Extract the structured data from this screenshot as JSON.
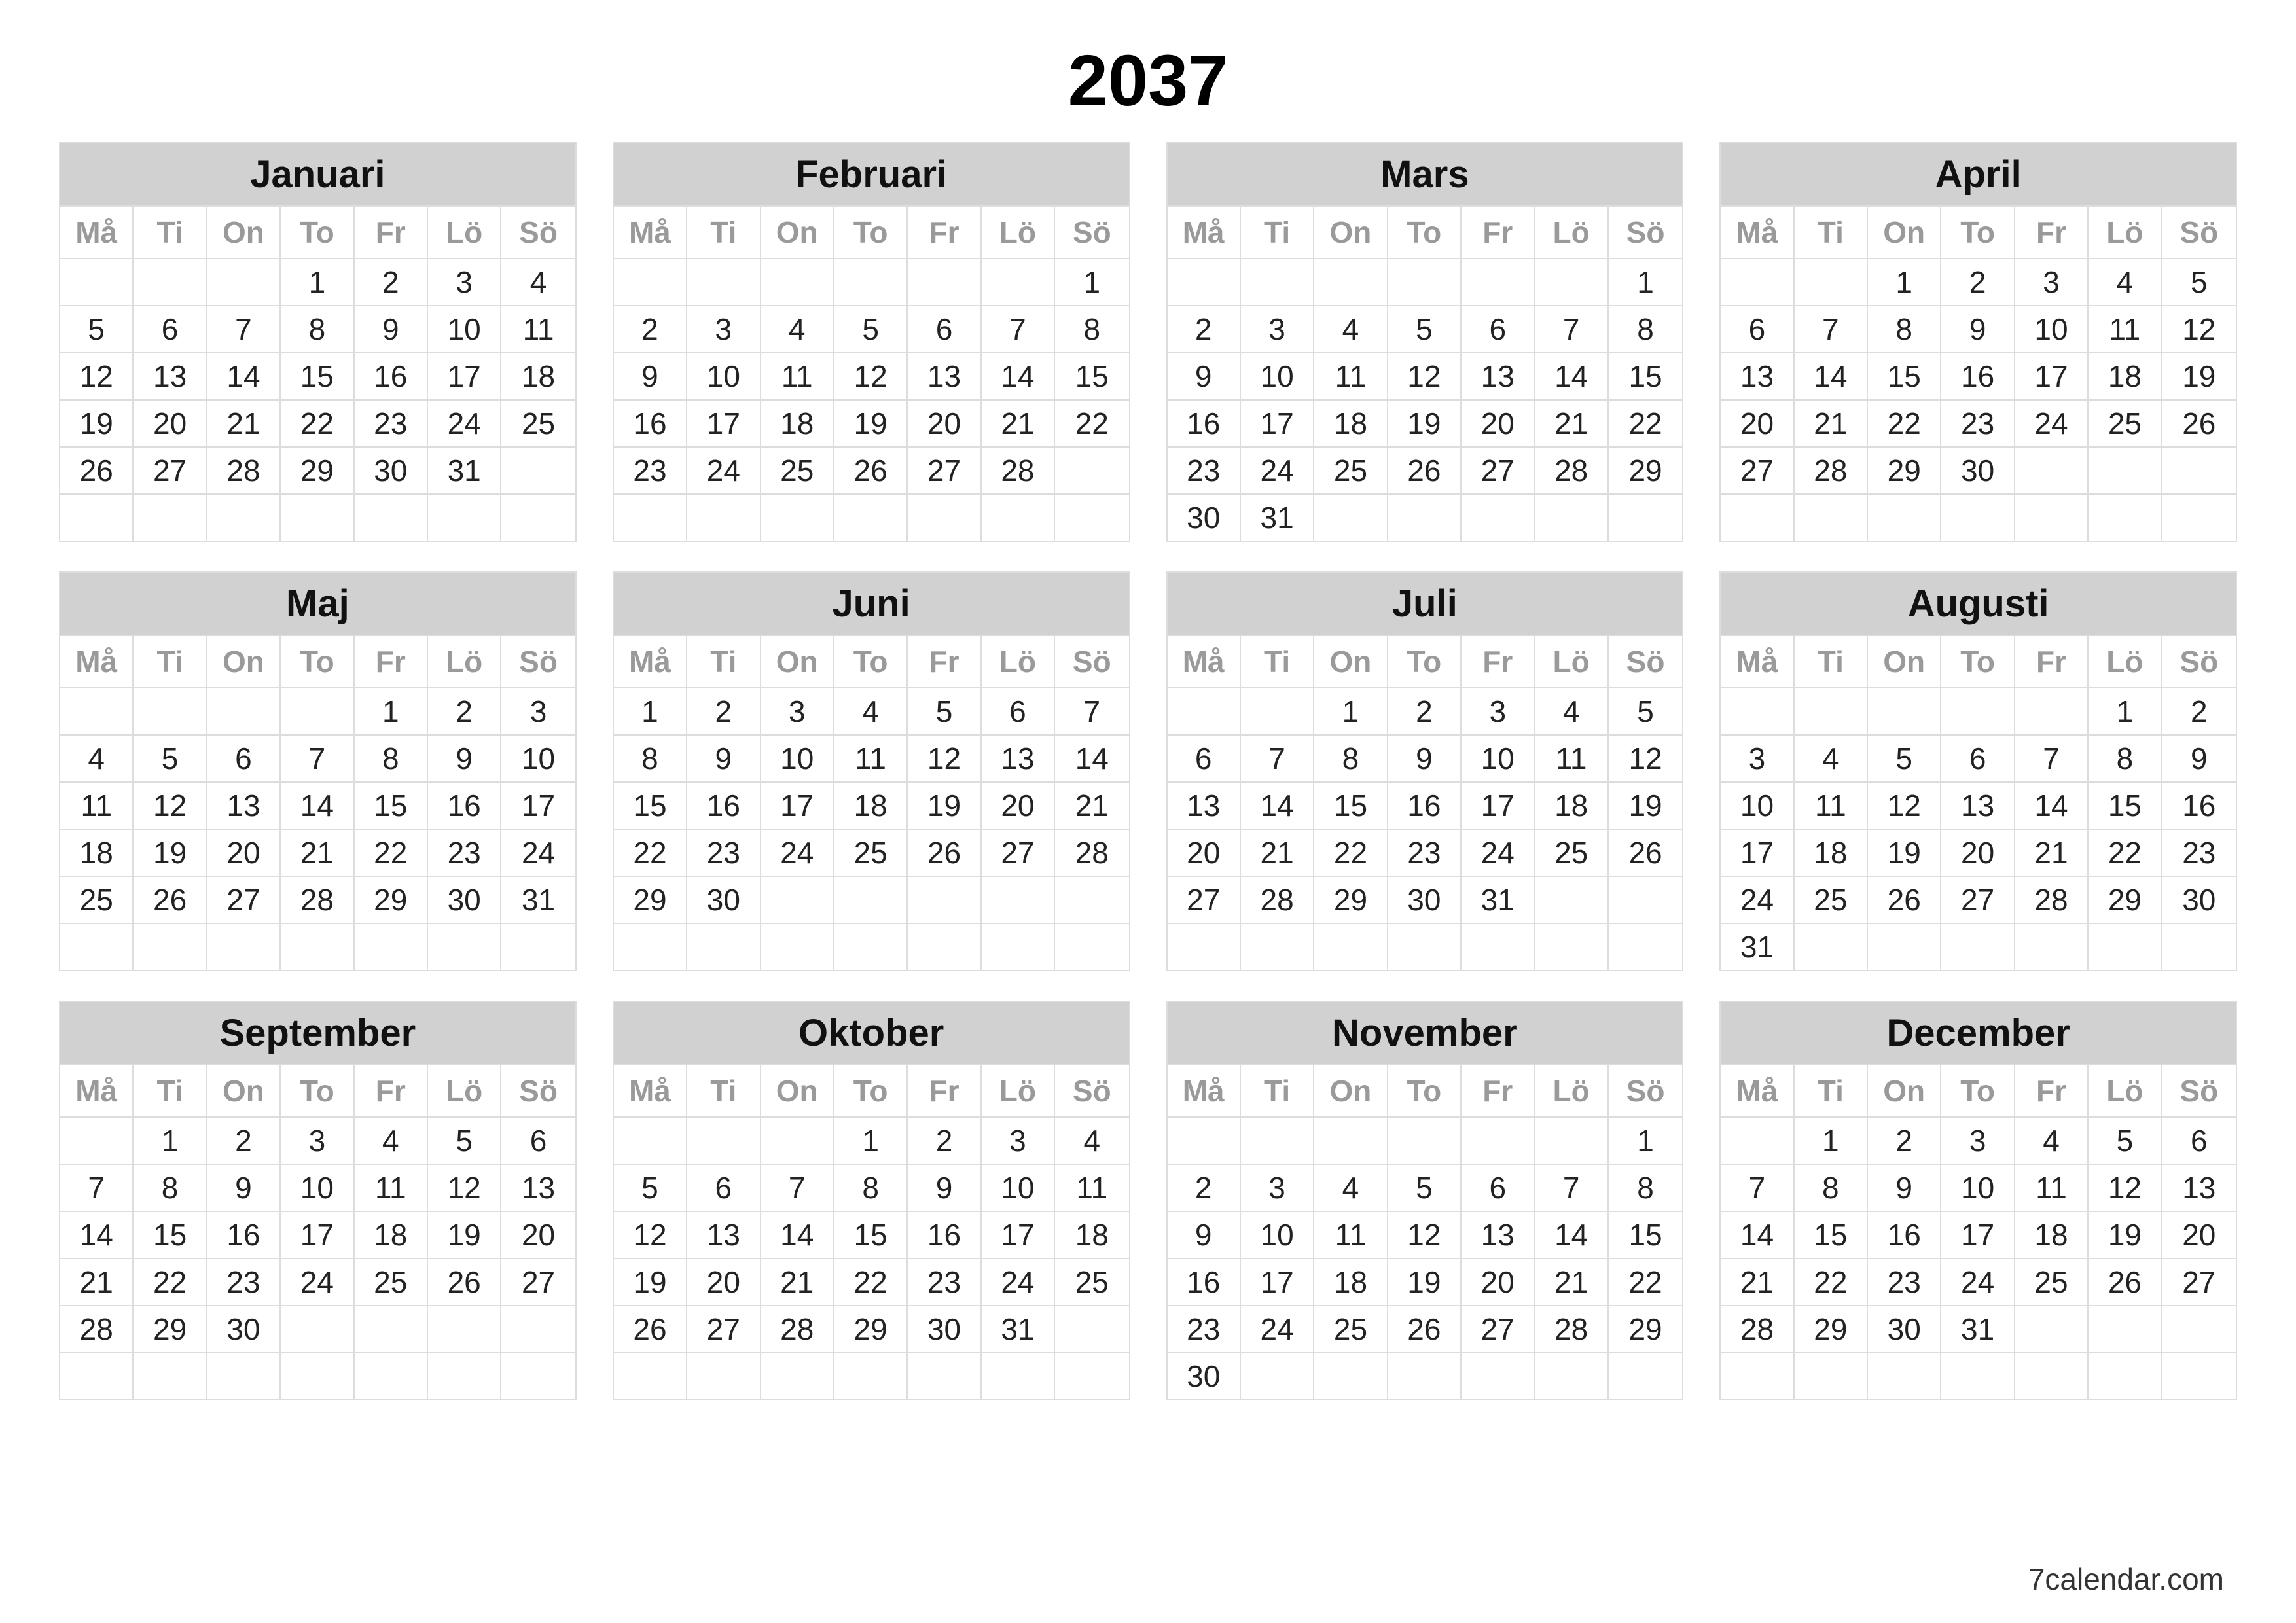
{
  "year": "2037",
  "footer": "7calendar.com",
  "weekdays": [
    "Må",
    "Ti",
    "On",
    "To",
    "Fr",
    "Lö",
    "Sö"
  ],
  "months": [
    {
      "name": "Januari",
      "startWeekday": 3,
      "days": 31
    },
    {
      "name": "Februari",
      "startWeekday": 6,
      "days": 28
    },
    {
      "name": "Mars",
      "startWeekday": 6,
      "days": 31
    },
    {
      "name": "April",
      "startWeekday": 2,
      "days": 30
    },
    {
      "name": "Maj",
      "startWeekday": 4,
      "days": 31
    },
    {
      "name": "Juni",
      "startWeekday": 0,
      "days": 30
    },
    {
      "name": "Juli",
      "startWeekday": 2,
      "days": 31
    },
    {
      "name": "Augusti",
      "startWeekday": 5,
      "days": 31
    },
    {
      "name": "September",
      "startWeekday": 1,
      "days": 30
    },
    {
      "name": "Oktober",
      "startWeekday": 3,
      "days": 31
    },
    {
      "name": "November",
      "startWeekday": 6,
      "days": 30
    },
    {
      "name": "December",
      "startWeekday": 1,
      "days": 31
    }
  ]
}
